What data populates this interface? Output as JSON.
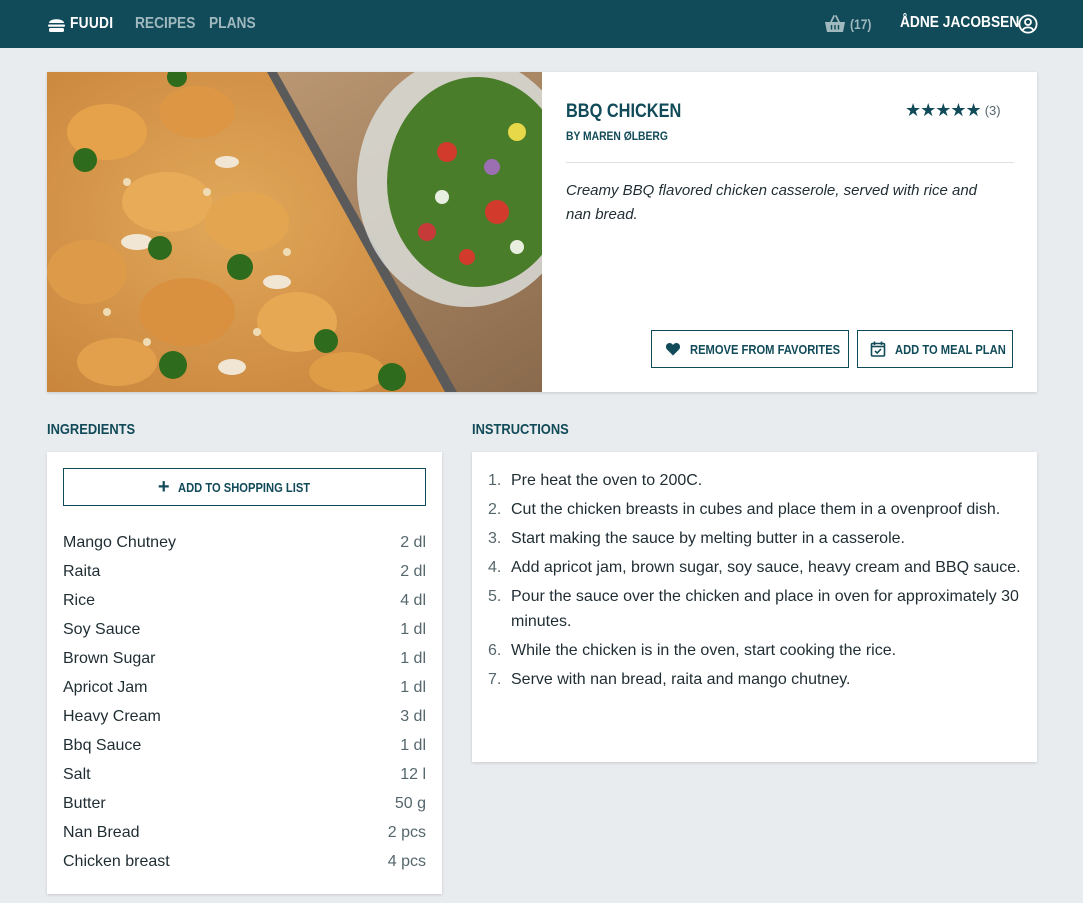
{
  "header": {
    "brand": "FUUDI",
    "nav": [
      {
        "label": "RECIPES"
      },
      {
        "label": "PLANS"
      }
    ],
    "cart_count": "(17)",
    "user_name": "ÅDNE JACOBSEN",
    "icons": {
      "logo": "burger-icon",
      "cart": "basket-icon",
      "user": "user-circle-icon"
    }
  },
  "recipe": {
    "title": "BBQ CHICKEN",
    "author": "BY MAREN ØLBERG",
    "rating": 5,
    "rating_count": "(3)",
    "description": "Creamy BBQ flavored chicken casserole, served with rice and nan bread.",
    "favorite_button": "REMOVE FROM FAVORITES",
    "meal_plan_button": "ADD TO MEAL PLAN"
  },
  "ingredients": {
    "heading": "INGREDIENTS",
    "shopping_button": "ADD TO SHOPPING LIST",
    "items": [
      {
        "name": "Mango Chutney",
        "amount": "2 dl"
      },
      {
        "name": "Raita",
        "amount": "2 dl"
      },
      {
        "name": "Rice",
        "amount": "4 dl"
      },
      {
        "name": "Soy Sauce",
        "amount": "1 dl"
      },
      {
        "name": "Brown Sugar",
        "amount": "1 dl"
      },
      {
        "name": "Apricot Jam",
        "amount": "1 dl"
      },
      {
        "name": "Heavy Cream",
        "amount": "3 dl"
      },
      {
        "name": "Bbq Sauce",
        "amount": "1 dl"
      },
      {
        "name": "Salt",
        "amount": "12 l"
      },
      {
        "name": "Butter",
        "amount": "50 g"
      },
      {
        "name": "Nan Bread",
        "amount": "2 pcs"
      },
      {
        "name": "Chicken breast",
        "amount": "4 pcs"
      }
    ]
  },
  "instructions": {
    "heading": "INSTRUCTIONS",
    "steps": [
      {
        "num": "1.",
        "text": "Pre heat the oven to 200C."
      },
      {
        "num": "2.",
        "text": "Cut the chicken breasts in cubes and place them in a ovenproof dish."
      },
      {
        "num": "3.",
        "text": "Start making the sauce by melting butter in a casserole."
      },
      {
        "num": "4.",
        "text": "Add apricot jam, brown sugar, soy sauce, heavy cream and BBQ sauce."
      },
      {
        "num": "5.",
        "text": "Pour the sauce over the chicken and place in oven for approximately 30 minutes."
      },
      {
        "num": "6.",
        "text": "While the chicken is in the oven, start cooking the rice."
      },
      {
        "num": "7.",
        "text": "Serve with nan bread, raita and mango chutney."
      }
    ]
  },
  "colors": {
    "primary": "#114a58",
    "background": "#e9ecef",
    "text": "#1f2d33"
  }
}
